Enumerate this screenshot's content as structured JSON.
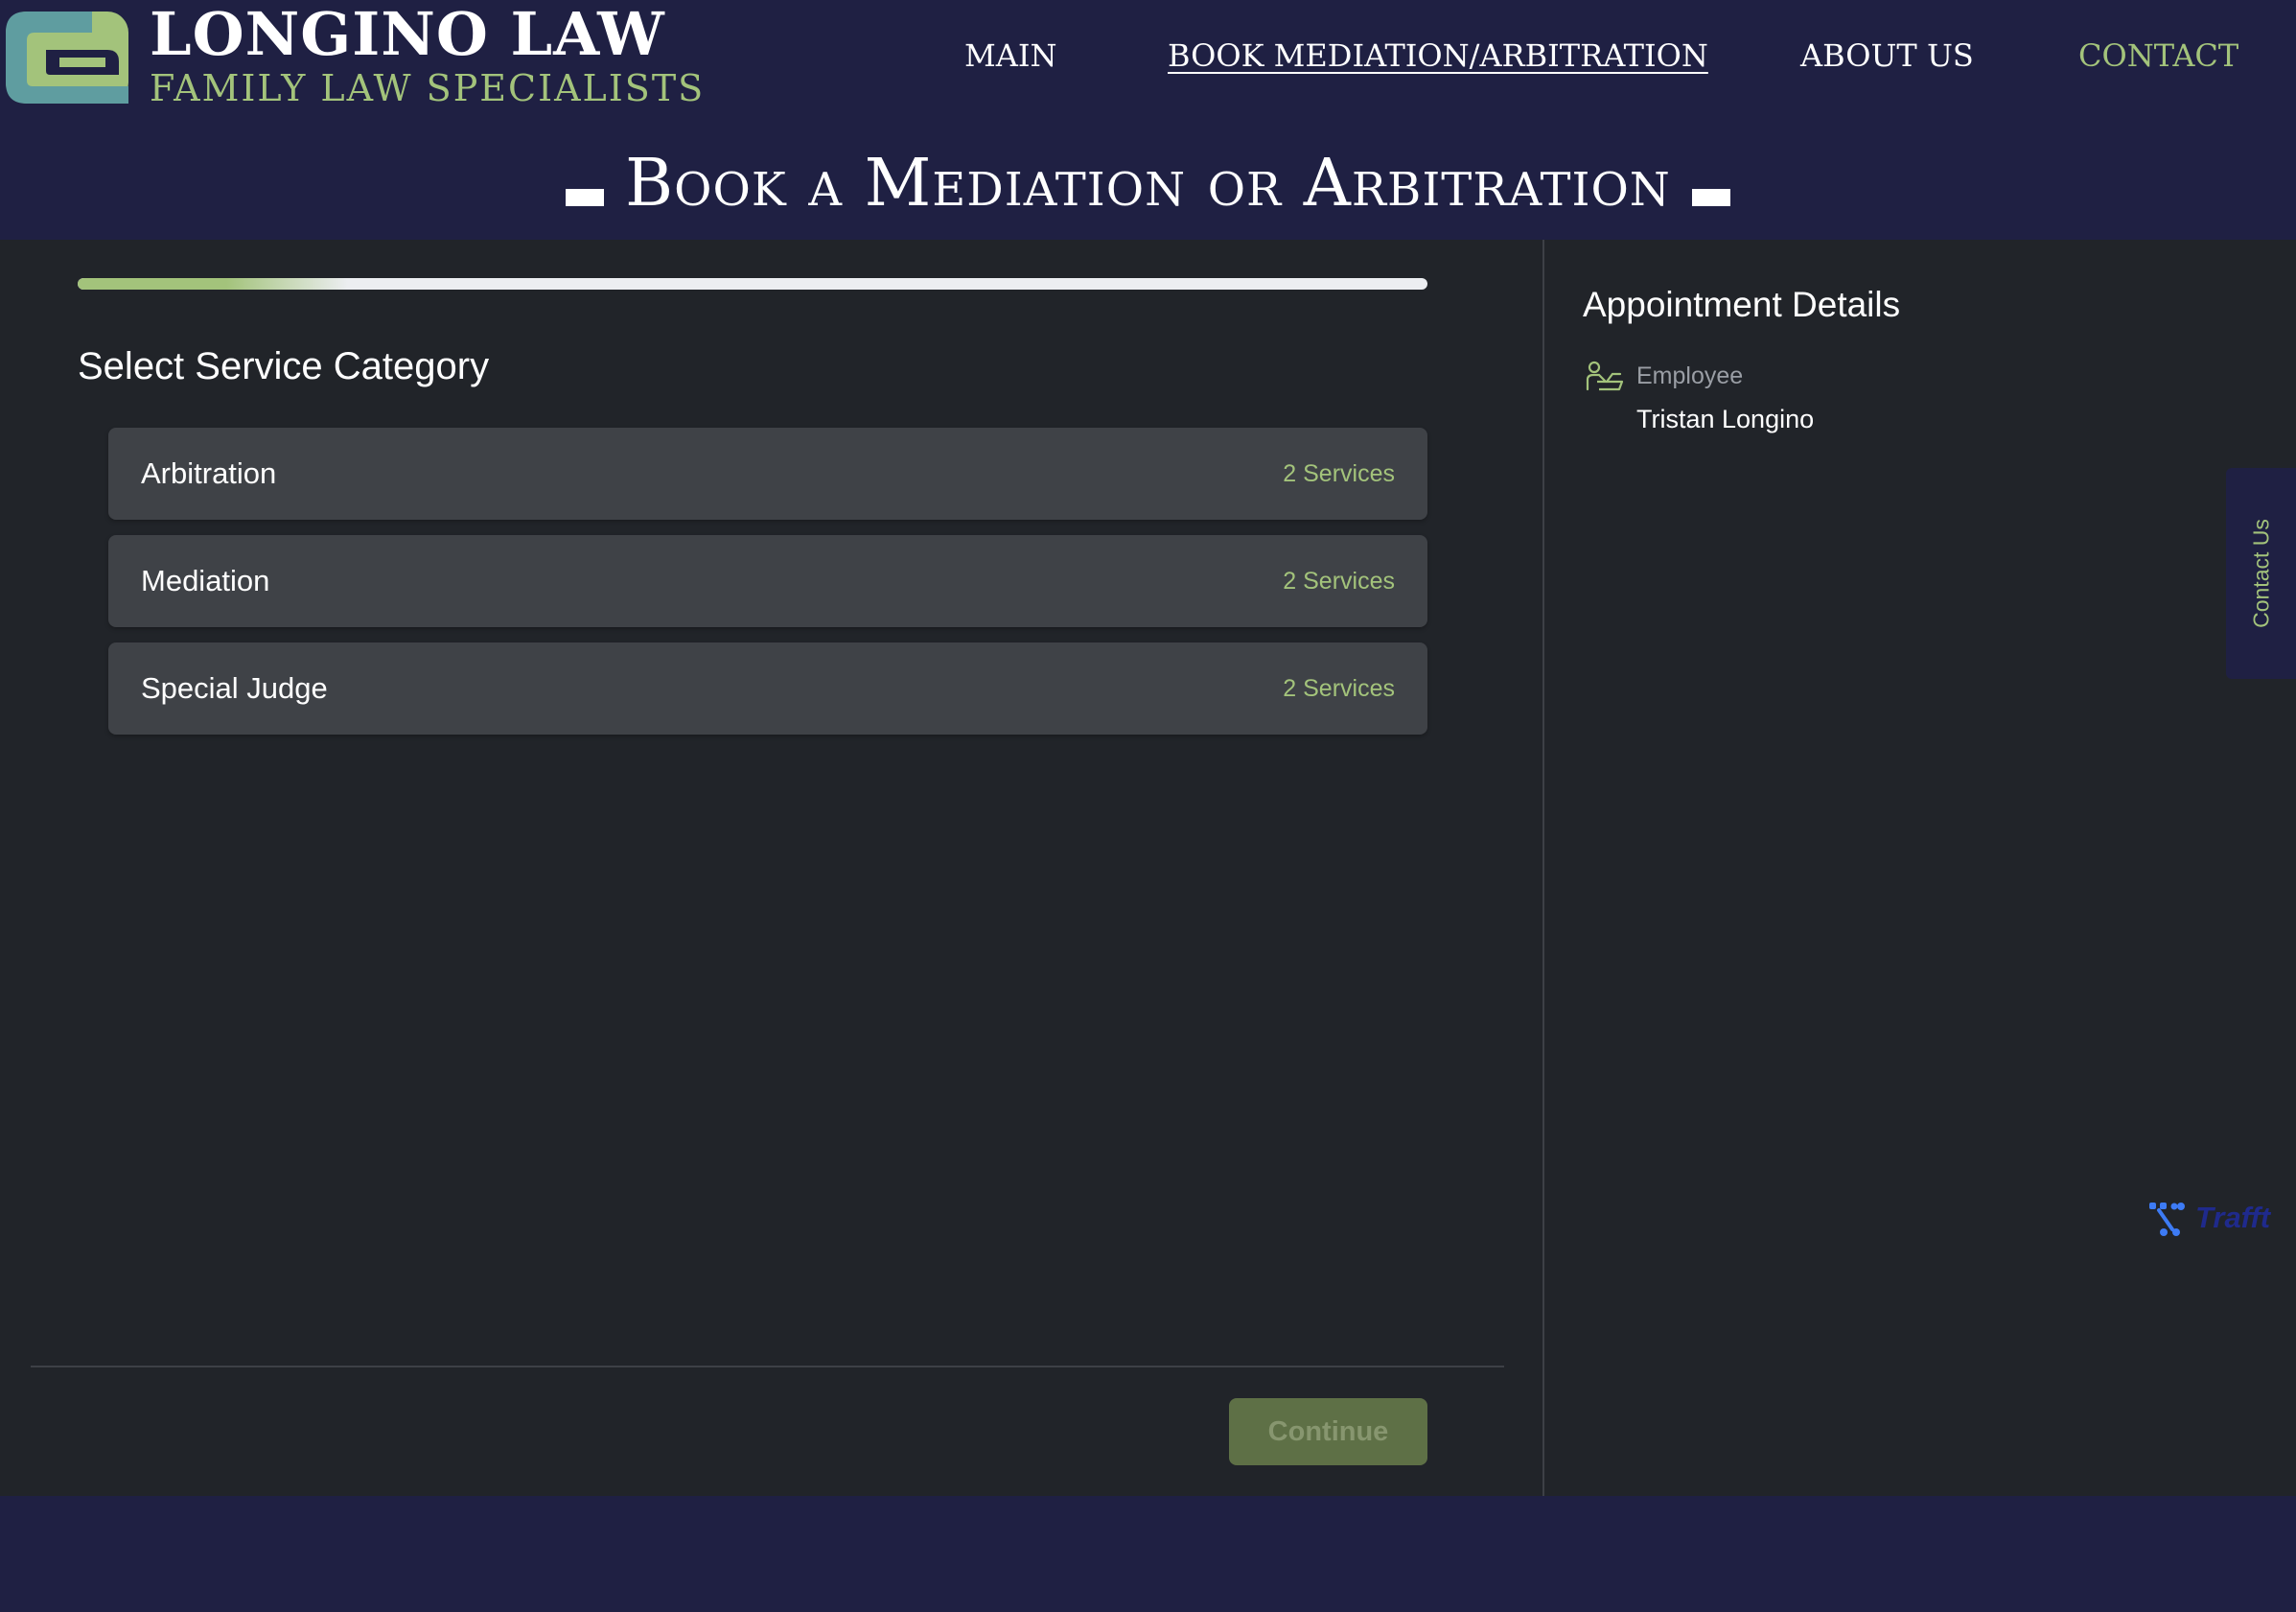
{
  "brand": {
    "name": "LONGINO LAW",
    "tagline": "FAMILY LAW SPECIALISTS"
  },
  "nav": [
    {
      "label": "MAIN"
    },
    {
      "label": "BOOK MEDIATION/ARBITRATION"
    },
    {
      "label": "ABOUT US"
    },
    {
      "label": "CONTACT"
    }
  ],
  "page": {
    "title": "Book a Mediation or Arbitration"
  },
  "booking": {
    "progress_fraction": 0.2,
    "step_title": "Select Service Category",
    "categories": [
      {
        "name": "Arbitration",
        "count": "2 Services"
      },
      {
        "name": "Mediation",
        "count": "2 Services"
      },
      {
        "name": "Special Judge",
        "count": "2 Services"
      }
    ],
    "continue_label": "Continue"
  },
  "details": {
    "title": "Appointment Details",
    "employee_label": "Employee",
    "employee_value": "Tristan Longino"
  },
  "contact_tab": "Contact Us",
  "powered_by": "Trafft",
  "colors": {
    "header_bg": "#1f2043",
    "panel_bg": "#212429",
    "card_bg": "#3f4247",
    "accent": "#a3c37b",
    "continue_bg": "#5e7046",
    "trafft_blue": "#1f2a8c"
  }
}
